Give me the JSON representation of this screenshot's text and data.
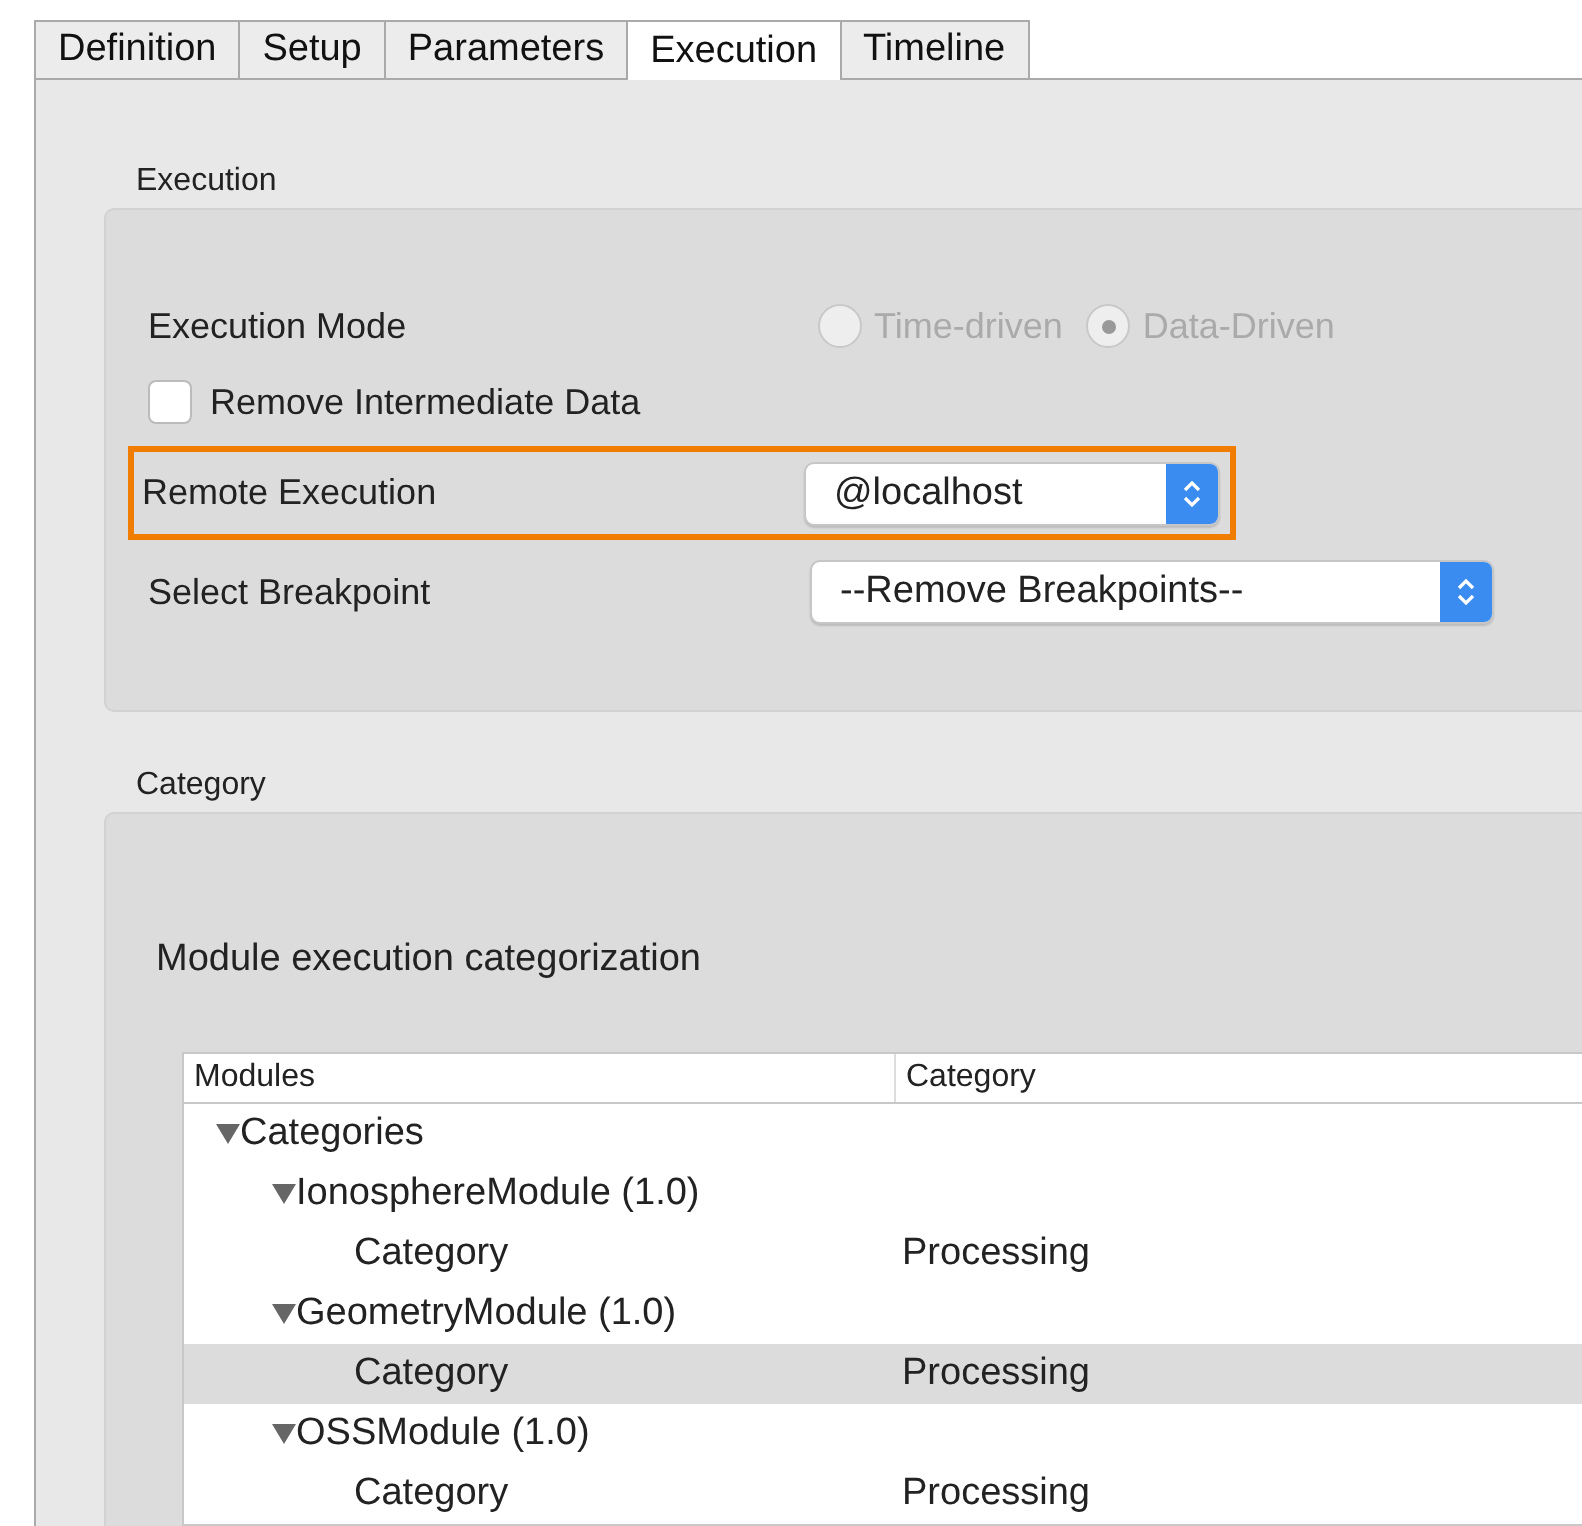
{
  "tabs": [
    {
      "label": "Definition",
      "selected": false
    },
    {
      "label": "Setup",
      "selected": false
    },
    {
      "label": "Parameters",
      "selected": false
    },
    {
      "label": "Execution",
      "selected": true
    },
    {
      "label": "Timeline",
      "selected": false
    }
  ],
  "execution": {
    "title": "Execution",
    "mode": {
      "label": "Execution Mode",
      "disabled": true,
      "options": [
        {
          "label": "Time-driven",
          "selected": false
        },
        {
          "label": "Data-Driven",
          "selected": true
        }
      ]
    },
    "remove_intermediate": {
      "label": "Remove Intermediate Data",
      "checked": false
    },
    "remote": {
      "label": "Remote Execution",
      "value": "@localhost",
      "highlighted": true
    },
    "breakpoint": {
      "label": "Select Breakpoint",
      "value": "--Remove Breakpoints--",
      "highlighted": false
    }
  },
  "category": {
    "title": "Category",
    "caption": "Module execution categorization",
    "table": {
      "columns": [
        "Modules",
        "Category"
      ],
      "rows": [
        {
          "name": "Categories",
          "expanded": true,
          "selected": false,
          "children": [
            {
              "name": "IonosphereModule (1.0)",
              "expanded": true,
              "selected": false,
              "children": [
                {
                  "name": "Category",
                  "value": "Processing",
                  "selected": false
                }
              ]
            },
            {
              "name": "GeometryModule (1.0)",
              "expanded": true,
              "selected": false,
              "children": [
                {
                  "name": "Category",
                  "value": "Processing",
                  "selected": true
                }
              ]
            },
            {
              "name": "OSSModule (1.0)",
              "expanded": true,
              "selected": false,
              "children": [
                {
                  "name": "Category",
                  "value": "Processing",
                  "selected": false
                }
              ]
            }
          ]
        }
      ]
    }
  }
}
